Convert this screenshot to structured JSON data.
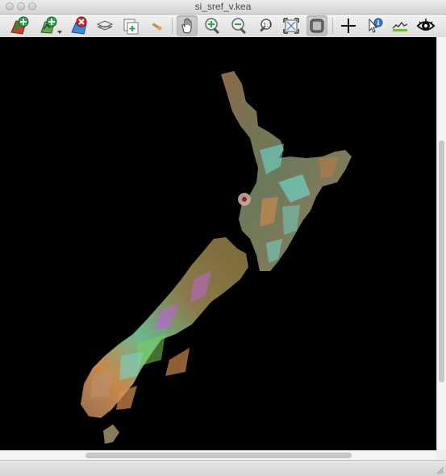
{
  "window": {
    "title": "si_sref_v.kea"
  },
  "toolbar": {
    "buttons": [
      {
        "name": "add-layer",
        "icon": "add-layer-icon"
      },
      {
        "name": "add-vector",
        "icon": "add-vector-icon",
        "has_dropdown": true
      },
      {
        "name": "remove-layer",
        "icon": "remove-layer-icon"
      },
      {
        "name": "layers",
        "icon": "layers-icon"
      },
      {
        "name": "new-window",
        "icon": "new-window-icon"
      },
      {
        "name": "tools",
        "icon": "tools-icon"
      },
      {
        "name": "pan",
        "icon": "pan-hand-icon",
        "active": true
      },
      {
        "name": "zoom-in",
        "icon": "zoom-in-icon"
      },
      {
        "name": "zoom-out",
        "icon": "zoom-out-icon"
      },
      {
        "name": "zoom-native",
        "icon": "zoom-native-icon"
      },
      {
        "name": "zoom-full-extent",
        "icon": "zoom-full-extent-icon"
      },
      {
        "name": "follow-extent",
        "icon": "follow-extent-icon",
        "active": true
      },
      {
        "name": "query",
        "icon": "crosshair-icon"
      },
      {
        "name": "query-info",
        "icon": "query-info-icon"
      },
      {
        "name": "profile",
        "icon": "profile-icon"
      },
      {
        "name": "view-options",
        "icon": "eye-icon"
      }
    ]
  },
  "colors": {
    "canvas_background": "#000000",
    "land_olive": "#7a6a3a",
    "land_orange": "#c8884a",
    "land_cyan": "#6fe0d8",
    "land_magenta": "#c060d8",
    "land_green": "#7acd5a"
  }
}
